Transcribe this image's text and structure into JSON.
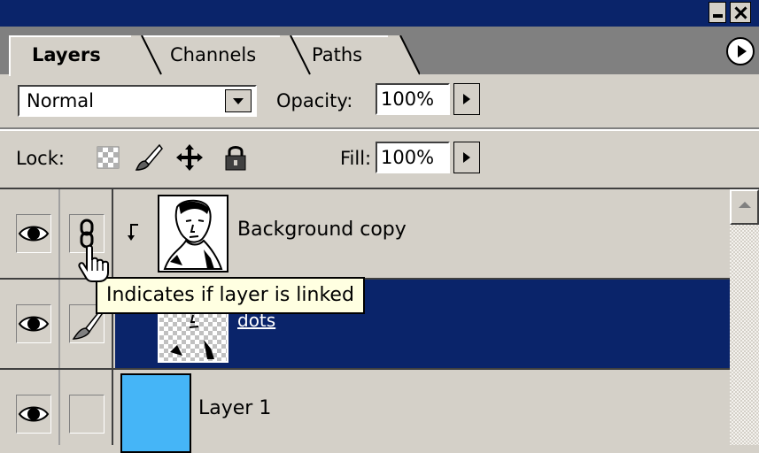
{
  "panel": {
    "tabs": [
      {
        "label": "Layers",
        "active": true
      },
      {
        "label": "Channels",
        "active": false
      },
      {
        "label": "Paths",
        "active": false
      }
    ]
  },
  "controls": {
    "blend_mode": "Normal",
    "opacity_label": "Opacity:",
    "opacity_value": "100%",
    "lock_label": "Lock:",
    "fill_label": "Fill:",
    "fill_value": "100%"
  },
  "layers": [
    {
      "name": "Background copy",
      "visible": true,
      "linked": true,
      "selected": false,
      "clipped": true,
      "thumbnail": "portrait"
    },
    {
      "name": "dots",
      "visible": true,
      "linked": false,
      "brush": true,
      "selected": true,
      "thumbnail": "portrait-transparent"
    },
    {
      "name": "Layer 1",
      "visible": true,
      "linked": false,
      "selected": false,
      "thumbnail": "solid-blue"
    }
  ],
  "tooltip": {
    "text": "Indicates if layer is linked"
  },
  "colors": {
    "selection": "#0a246a",
    "titlebar": "#0a246a",
    "panel": "#d4d0c8",
    "tooltip_bg": "#ffffe1",
    "layer1_fill": "#45b5f7"
  }
}
